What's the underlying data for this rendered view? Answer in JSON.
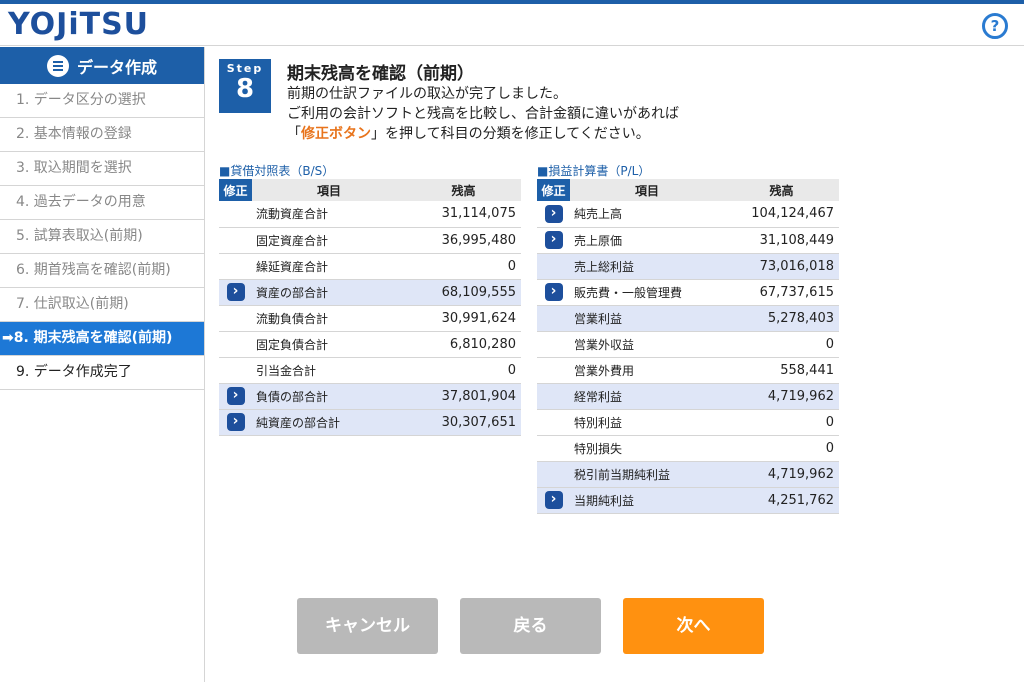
{
  "app": {
    "logo": "YOJiTSU",
    "help_icon": "?"
  },
  "sidebar": {
    "header": "データ作成",
    "items": [
      {
        "label": "1. データ区分の選択"
      },
      {
        "label": "2. 基本情報の登録"
      },
      {
        "label": "3. 取込期間を選択"
      },
      {
        "label": "4. 過去データの用意"
      },
      {
        "label": "5. 試算表取込(前期)"
      },
      {
        "label": "6. 期首残高を確認(前期)"
      },
      {
        "label": "7. 仕訳取込(前期)"
      },
      {
        "label": "➡8. 期末残高を確認(前期)"
      },
      {
        "label": "9. データ作成完了"
      }
    ]
  },
  "step": {
    "word": "Step",
    "number": "8"
  },
  "title": "期末残高を確認（前期）",
  "desc": {
    "line1": "前期の仕訳ファイルの取込が完了しました。",
    "line2": "ご利用の会計ソフトと残高を比較し、合計金額に違いがあれば",
    "line3_open": "「",
    "line3_hl": "修正ボタン",
    "line3_rest": "」を押して科目の分類を修正してください。"
  },
  "bs": {
    "title": "■貸借対照表（B/S）",
    "headers": {
      "fix": "修正",
      "item": "項目",
      "balance": "残高"
    },
    "rows": [
      {
        "name": "流動資産合計",
        "value": "31,114,075"
      },
      {
        "name": "固定資産合計",
        "value": "36,995,480"
      },
      {
        "name": "繰延資産合計",
        "value": "0"
      },
      {
        "name": "資産の部合計",
        "value": "68,109,555"
      },
      {
        "name": "流動負債合計",
        "value": "30,991,624"
      },
      {
        "name": "固定負債合計",
        "value": "6,810,280"
      },
      {
        "name": "引当金合計",
        "value": "0"
      },
      {
        "name": "負債の部合計",
        "value": "37,801,904"
      },
      {
        "name": "純資産の部合計",
        "value": "30,307,651"
      }
    ]
  },
  "pl": {
    "title": "■損益計算書（P/L）",
    "headers": {
      "fix": "修正",
      "item": "項目",
      "balance": "残高"
    },
    "rows": [
      {
        "name": "純売上高",
        "value": "104,124,467"
      },
      {
        "name": "売上原価",
        "value": "31,108,449"
      },
      {
        "name": "売上総利益",
        "value": "73,016,018"
      },
      {
        "name": "販売費・一般管理費",
        "value": "67,737,615"
      },
      {
        "name": "営業利益",
        "value": "5,278,403"
      },
      {
        "name": "営業外収益",
        "value": "0"
      },
      {
        "name": "営業外費用",
        "value": "558,441"
      },
      {
        "name": "経常利益",
        "value": "4,719,962"
      },
      {
        "name": "特別利益",
        "value": "0"
      },
      {
        "name": "特別損失",
        "value": "0"
      },
      {
        "name": "税引前当期純利益",
        "value": "4,719,962"
      },
      {
        "name": "当期純利益",
        "value": "4,251,762"
      }
    ]
  },
  "buttons": {
    "cancel": "キャンセル",
    "back": "戻る",
    "next": "次へ"
  },
  "colors": {
    "brand": "#1d5fa8",
    "accent": "#ff9110",
    "highlight_row": "#dfe6f7",
    "disabled": "#b9b9b9"
  }
}
